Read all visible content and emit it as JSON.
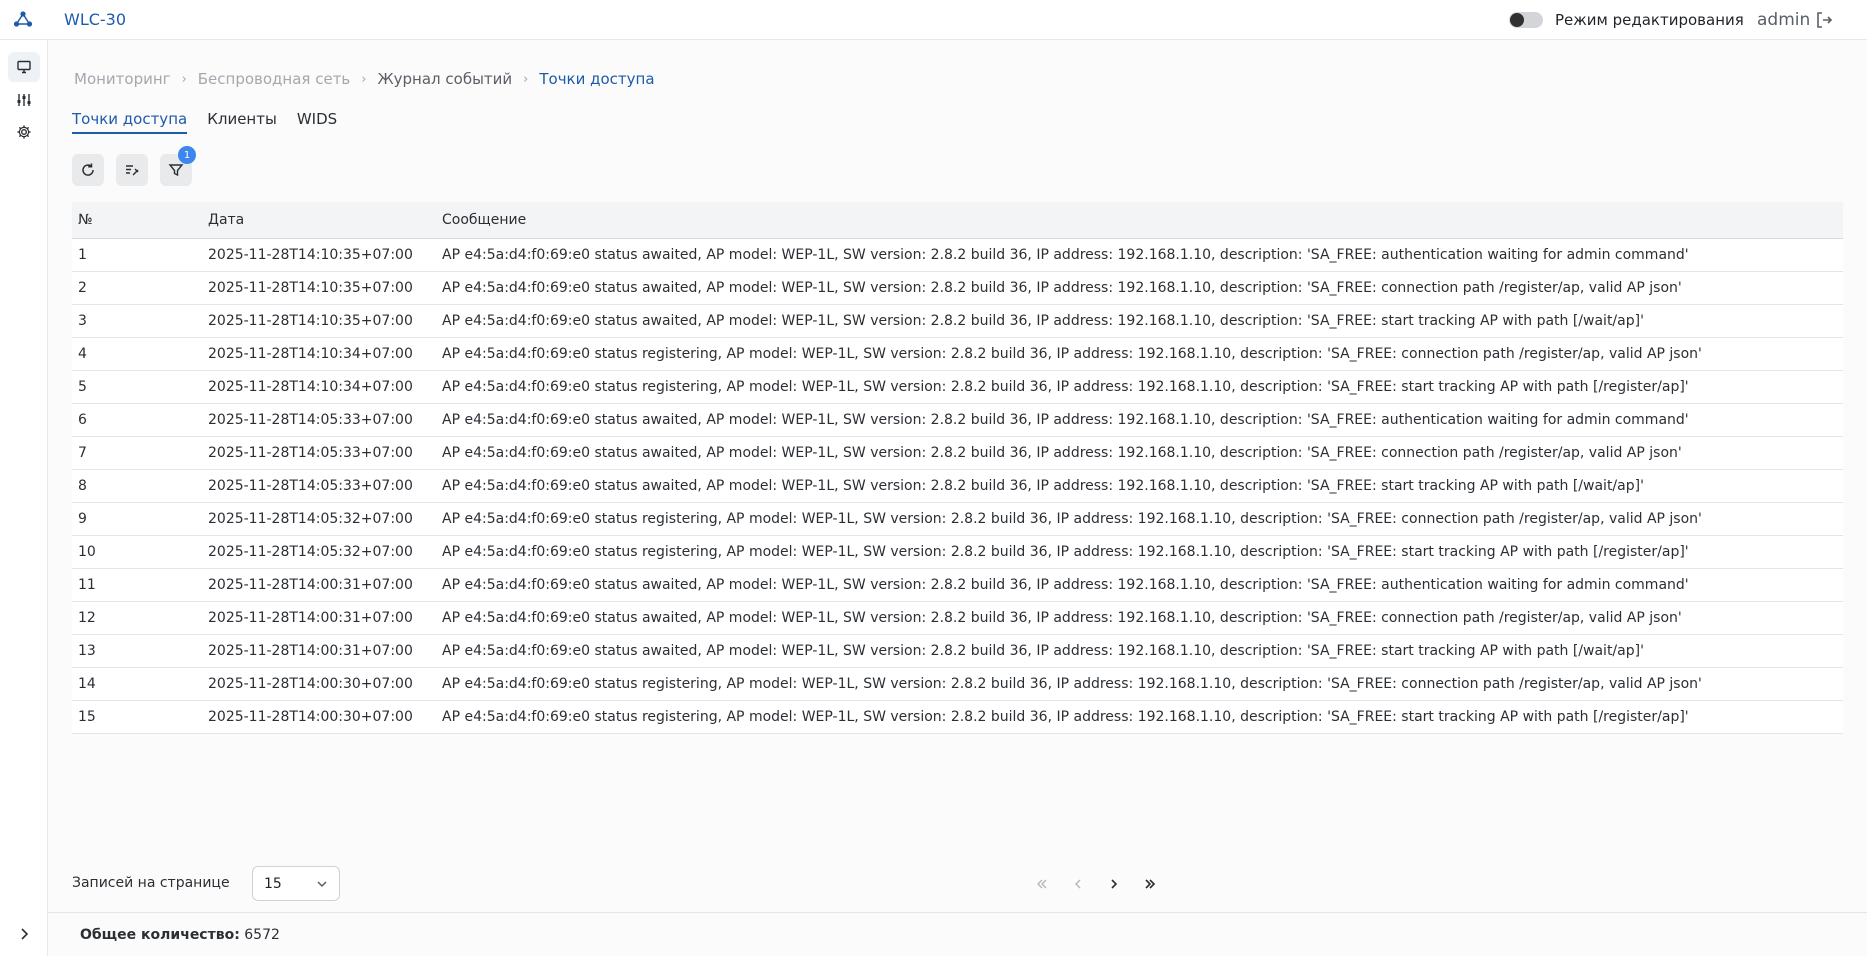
{
  "app": {
    "title": "WLC-30"
  },
  "header": {
    "edit_mode_label": "Режим редактирования",
    "user": "admin"
  },
  "sidebar": {
    "items": [
      "monitor-icon",
      "sliders-icon",
      "gear-icon"
    ]
  },
  "breadcrumb": [
    "Мониторинг",
    "Беспроводная сеть",
    "Журнал событий",
    "Точки доступа"
  ],
  "tabs": [
    "Точки доступа",
    "Клиенты",
    "WIDS"
  ],
  "toolbar": {
    "filter_badge": "1"
  },
  "table": {
    "headers": [
      "№",
      "Дата",
      "Сообщение"
    ],
    "rows": [
      [
        "1",
        "2025-11-28T14:10:35+07:00",
        "AP e4:5a:d4:f0:69:e0 status awaited, AP model: WEP-1L, SW version: 2.8.2 build 36, IP address: 192.168.1.10, description: 'SA_FREE: authentication waiting for admin command'"
      ],
      [
        "2",
        "2025-11-28T14:10:35+07:00",
        "AP e4:5a:d4:f0:69:e0 status awaited, AP model: WEP-1L, SW version: 2.8.2 build 36, IP address: 192.168.1.10, description: 'SA_FREE: connection path /register/ap, valid AP json'"
      ],
      [
        "3",
        "2025-11-28T14:10:35+07:00",
        "AP e4:5a:d4:f0:69:e0 status awaited, AP model: WEP-1L, SW version: 2.8.2 build 36, IP address: 192.168.1.10, description: 'SA_FREE: start tracking AP with path [/wait/ap]'"
      ],
      [
        "4",
        "2025-11-28T14:10:34+07:00",
        "AP e4:5a:d4:f0:69:e0 status registering, AP model: WEP-1L, SW version: 2.8.2 build 36, IP address: 192.168.1.10, description: 'SA_FREE: connection path /register/ap, valid AP json'"
      ],
      [
        "5",
        "2025-11-28T14:10:34+07:00",
        "AP e4:5a:d4:f0:69:e0 status registering, AP model: WEP-1L, SW version: 2.8.2 build 36, IP address: 192.168.1.10, description: 'SA_FREE: start tracking AP with path [/register/ap]'"
      ],
      [
        "6",
        "2025-11-28T14:05:33+07:00",
        "AP e4:5a:d4:f0:69:e0 status awaited, AP model: WEP-1L, SW version: 2.8.2 build 36, IP address: 192.168.1.10, description: 'SA_FREE: authentication waiting for admin command'"
      ],
      [
        "7",
        "2025-11-28T14:05:33+07:00",
        "AP e4:5a:d4:f0:69:e0 status awaited, AP model: WEP-1L, SW version: 2.8.2 build 36, IP address: 192.168.1.10, description: 'SA_FREE: connection path /register/ap, valid AP json'"
      ],
      [
        "8",
        "2025-11-28T14:05:33+07:00",
        "AP e4:5a:d4:f0:69:e0 status awaited, AP model: WEP-1L, SW version: 2.8.2 build 36, IP address: 192.168.1.10, description: 'SA_FREE: start tracking AP with path [/wait/ap]'"
      ],
      [
        "9",
        "2025-11-28T14:05:32+07:00",
        "AP e4:5a:d4:f0:69:e0 status registering, AP model: WEP-1L, SW version: 2.8.2 build 36, IP address: 192.168.1.10, description: 'SA_FREE: connection path /register/ap, valid AP json'"
      ],
      [
        "10",
        "2025-11-28T14:05:32+07:00",
        "AP e4:5a:d4:f0:69:e0 status registering, AP model: WEP-1L, SW version: 2.8.2 build 36, IP address: 192.168.1.10, description: 'SA_FREE: start tracking AP with path [/register/ap]'"
      ],
      [
        "11",
        "2025-11-28T14:00:31+07:00",
        "AP e4:5a:d4:f0:69:e0 status awaited, AP model: WEP-1L, SW version: 2.8.2 build 36, IP address: 192.168.1.10, description: 'SA_FREE: authentication waiting for admin command'"
      ],
      [
        "12",
        "2025-11-28T14:00:31+07:00",
        "AP e4:5a:d4:f0:69:e0 status awaited, AP model: WEP-1L, SW version: 2.8.2 build 36, IP address: 192.168.1.10, description: 'SA_FREE: connection path /register/ap, valid AP json'"
      ],
      [
        "13",
        "2025-11-28T14:00:31+07:00",
        "AP e4:5a:d4:f0:69:e0 status awaited, AP model: WEP-1L, SW version: 2.8.2 build 36, IP address: 192.168.1.10, description: 'SA_FREE: start tracking AP with path [/wait/ap]'"
      ],
      [
        "14",
        "2025-11-28T14:00:30+07:00",
        "AP e4:5a:d4:f0:69:e0 status registering, AP model: WEP-1L, SW version: 2.8.2 build 36, IP address: 192.168.1.10, description: 'SA_FREE: connection path /register/ap, valid AP json'"
      ],
      [
        "15",
        "2025-11-28T14:00:30+07:00",
        "AP e4:5a:d4:f0:69:e0 status registering, AP model: WEP-1L, SW version: 2.8.2 build 36, IP address: 192.168.1.10, description: 'SA_FREE: start tracking AP with path [/register/ap]'"
      ]
    ]
  },
  "pagination": {
    "per_page_label": "Записей на странице",
    "per_page_value": "15",
    "first": "«",
    "prev": "‹",
    "next": "›",
    "last": "»"
  },
  "footer": {
    "total_label": "Общее количество:",
    "total_value": "6572"
  },
  "colors": {
    "accent": "#1e5ba8",
    "badge": "#3d86f0",
    "header_bg": "#f3f4f6"
  }
}
